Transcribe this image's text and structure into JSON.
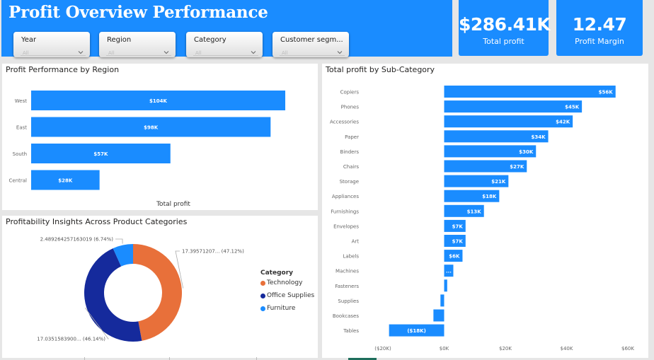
{
  "header": {
    "title": "Profit Overview Performance",
    "slicers": [
      {
        "label": "Year",
        "value": "All"
      },
      {
        "label": "Region",
        "value": "All"
      },
      {
        "label": "Category",
        "value": "All"
      },
      {
        "label": "Customer segm...",
        "value": "All"
      }
    ]
  },
  "kpis": [
    {
      "value": "$286.41K",
      "caption": "Total profit"
    },
    {
      "value": "12.47",
      "caption": "Profit Margin"
    }
  ],
  "colors": {
    "accent": "#1a8cff",
    "technology": "#e8703a",
    "office_supplies": "#152a9c",
    "furniture": "#1a8cff"
  },
  "region_panel": {
    "title": "Profit Performance by Region",
    "chart_data": {
      "type": "bar",
      "orientation": "horizontal",
      "categories": [
        "West",
        "East",
        "South",
        "Central"
      ],
      "values": [
        104,
        98,
        57,
        28
      ],
      "labels": [
        "$104K",
        "$98K",
        "$57K",
        "$28K"
      ],
      "xlabel": "Total profit",
      "xlim": [
        0,
        115
      ]
    }
  },
  "subcat_panel": {
    "title": "Total profit by Sub-Category",
    "chart_data": {
      "type": "bar",
      "orientation": "horizontal",
      "categories": [
        "Copiers",
        "Phones",
        "Accessories",
        "Paper",
        "Binders",
        "Chairs",
        "Storage",
        "Appliances",
        "Furnishings",
        "Envelopes",
        "Art",
        "Labels",
        "Machines",
        "Fasteners",
        "Supplies",
        "Bookcases",
        "Tables"
      ],
      "values": [
        56,
        45,
        42,
        34,
        30,
        27,
        21,
        18,
        13,
        7,
        7,
        6,
        3,
        1,
        -1.2,
        -3.5,
        -18
      ],
      "labels": [
        "$56K",
        "$45K",
        "$42K",
        "$34K",
        "$30K",
        "$27K",
        "$21K",
        "$18K",
        "$13K",
        "$7K",
        "$7K",
        "$6K",
        "...",
        "",
        "",
        "",
        "($18K)"
      ],
      "xticks": [
        "($20K)",
        "$0K",
        "$20K",
        "$40K",
        "$60K"
      ],
      "xtick_values": [
        -20,
        0,
        20,
        40,
        60
      ],
      "xlim": [
        -20,
        60
      ]
    }
  },
  "donut_panel": {
    "title": "Profitability Insights Across Product Categories",
    "chart_data": {
      "type": "pie",
      "donut": true,
      "legend_title": "Category",
      "categories": [
        "Technology",
        "Office Supplies",
        "Furniture"
      ],
      "values": [
        47.12,
        46.14,
        6.74
      ],
      "labels": [
        "17.39571207... (47.12%)",
        "17.0351583900... (46.14%)",
        "2.489264257163019 (6.74%)"
      ]
    }
  }
}
